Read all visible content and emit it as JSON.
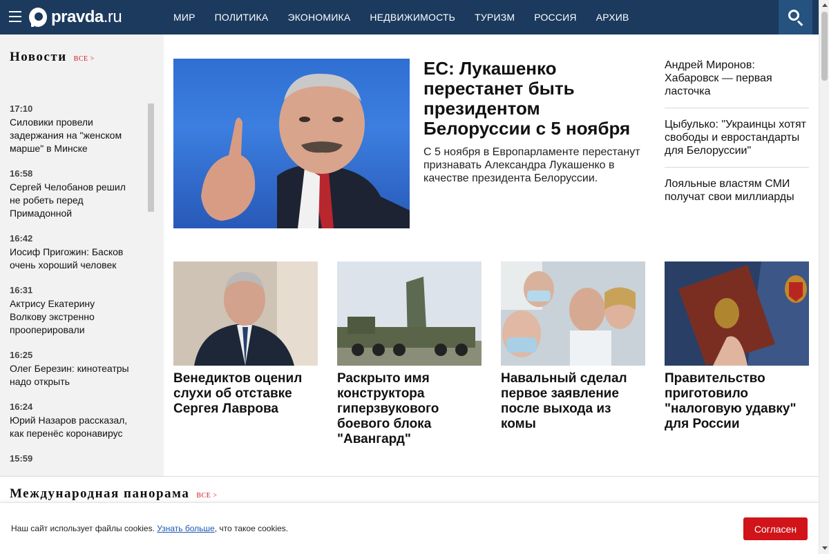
{
  "header": {
    "logo_text": "pravda",
    "logo_domain": ".ru",
    "nav": [
      "МИР",
      "ПОЛИТИКА",
      "ЭКОНОМИКА",
      "НЕДВИЖИМОСТЬ",
      "ТУРИЗМ",
      "РОССИЯ",
      "АРХИВ"
    ]
  },
  "news": {
    "title": "Новости",
    "all_link": "ВСЕ >",
    "items": [
      {
        "time": "17:10",
        "text": "Силовики провели задержания на \"женском марше\" в Минске"
      },
      {
        "time": "16:58",
        "text": "Сергей Челобанов решил не робеть перед Примадонной"
      },
      {
        "time": "16:42",
        "text": "Иосиф Пригожин: Басков очень хороший человек"
      },
      {
        "time": "16:31",
        "text": "Актрису Екатерину Волкову экстренно прооперировали"
      },
      {
        "time": "16:25",
        "text": "Олег Березин: кинотеатры надо открыть"
      },
      {
        "time": "16:24",
        "text": "Юрий Назаров рассказал, как перенёс коронавирус"
      },
      {
        "time": "15:59",
        "text": ""
      }
    ]
  },
  "lead": {
    "title": "ЕС: Лукашенко перестанет быть президентом Белоруссии с 5 ноября",
    "subtitle": "С 5 ноября в Европарламенте перестанут признавать Александра Лукашенко в качестве президента Белоруссии."
  },
  "side_headlines": [
    "Андрей Миронов: Хабаровск — первая ласточка",
    "Цыбулько: \"Украинцы хотят свободы и евростандарты для Белоруссии\"",
    "Лояльные властям СМИ получат свои миллиарды"
  ],
  "cards": [
    {
      "title": "Венедиктов оценил слухи об отставке Сергея Лаврова"
    },
    {
      "title": "Раскрыто имя конструктора гиперзвукового боевого блока \"Авангард\""
    },
    {
      "title": "Навальный сделал первое заявление после выхода из комы"
    },
    {
      "title": "Правительство приготовило \"налоговую удавку\" для России"
    }
  ],
  "intl": {
    "title": "Международная панорама",
    "all_link": "ВСЕ >"
  },
  "cookie": {
    "text_before": "Наш сайт использует файлы cookies. ",
    "link": "Узнать больше",
    "text_after": ", что такое cookies.",
    "button": "Согласен"
  }
}
